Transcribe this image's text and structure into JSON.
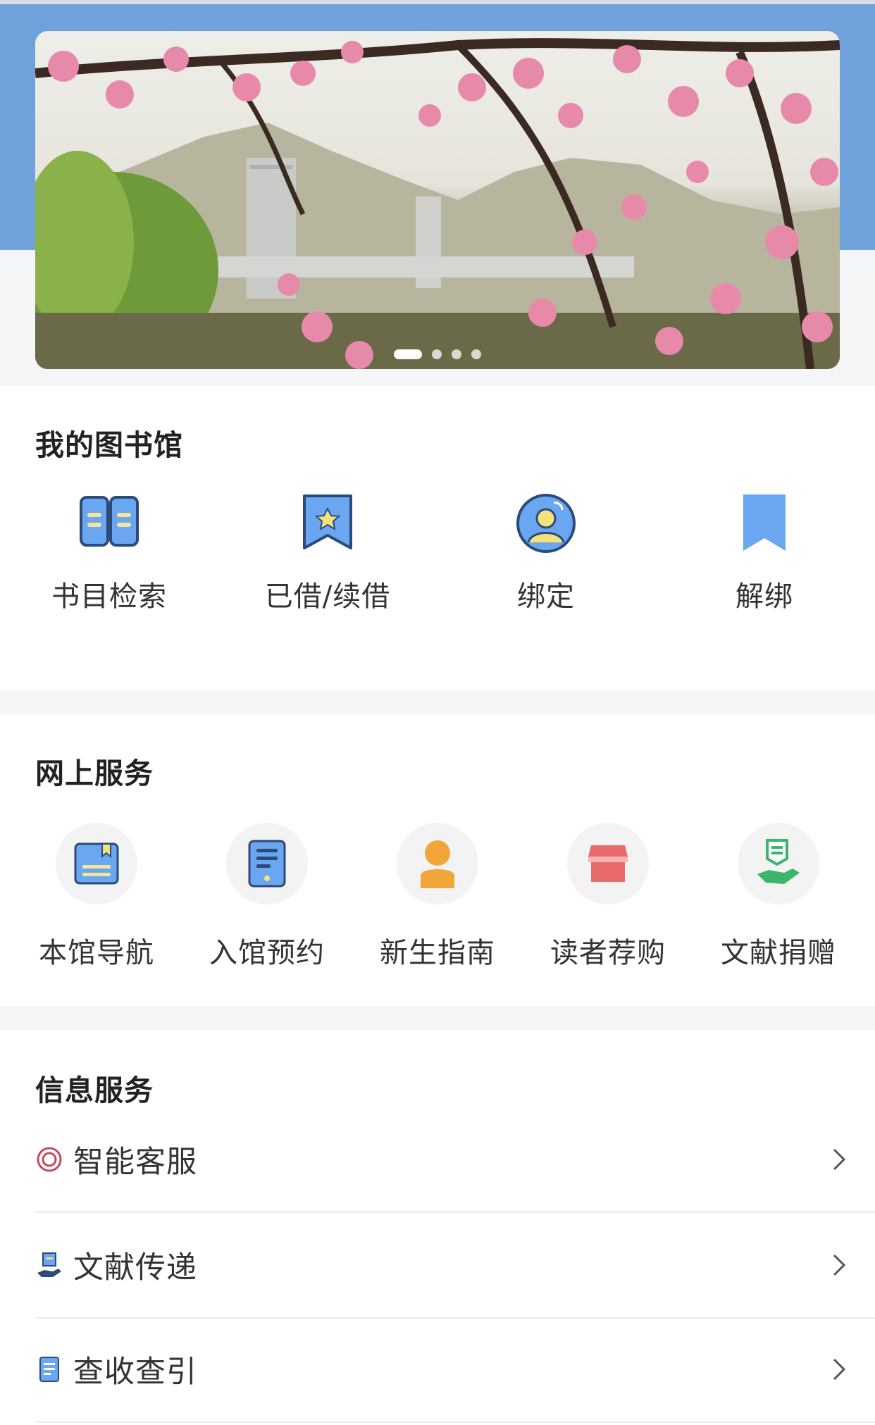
{
  "banner": {
    "image_label": "peach-blossom-campus-photo",
    "slide_count": 4,
    "active_slide": 1
  },
  "sections": {
    "my_library": {
      "title": "我的图书馆",
      "items": [
        {
          "label": "书目检索",
          "icon": "open-book-icon"
        },
        {
          "label": "已借/续借",
          "icon": "star-bookmark-icon"
        },
        {
          "label": "绑定",
          "icon": "user-avatar-icon"
        },
        {
          "label": "解绑",
          "icon": "bookmark-icon"
        }
      ]
    },
    "online_services": {
      "title": "网上服务",
      "items": [
        {
          "label": "本馆导航",
          "icon": "book-tag-icon"
        },
        {
          "label": "入馆预约",
          "icon": "tablet-doc-icon"
        },
        {
          "label": "新生指南",
          "icon": "person-icon"
        },
        {
          "label": "读者荐购",
          "icon": "shop-icon"
        },
        {
          "label": "文献捐赠",
          "icon": "hand-donate-icon"
        }
      ]
    },
    "info_services": {
      "title": "信息服务",
      "items": [
        {
          "label": "智能客服",
          "icon": "ring-icon"
        },
        {
          "label": "文献传递",
          "icon": "hand-doc-icon"
        },
        {
          "label": "查收查引",
          "icon": "document-icon"
        }
      ]
    }
  },
  "colors": {
    "top_band": "#6fa1db",
    "icon_blue": "#6aa7f0",
    "icon_orange": "#f2a63a",
    "icon_red": "#e96a6a",
    "icon_green": "#3bb56b"
  }
}
